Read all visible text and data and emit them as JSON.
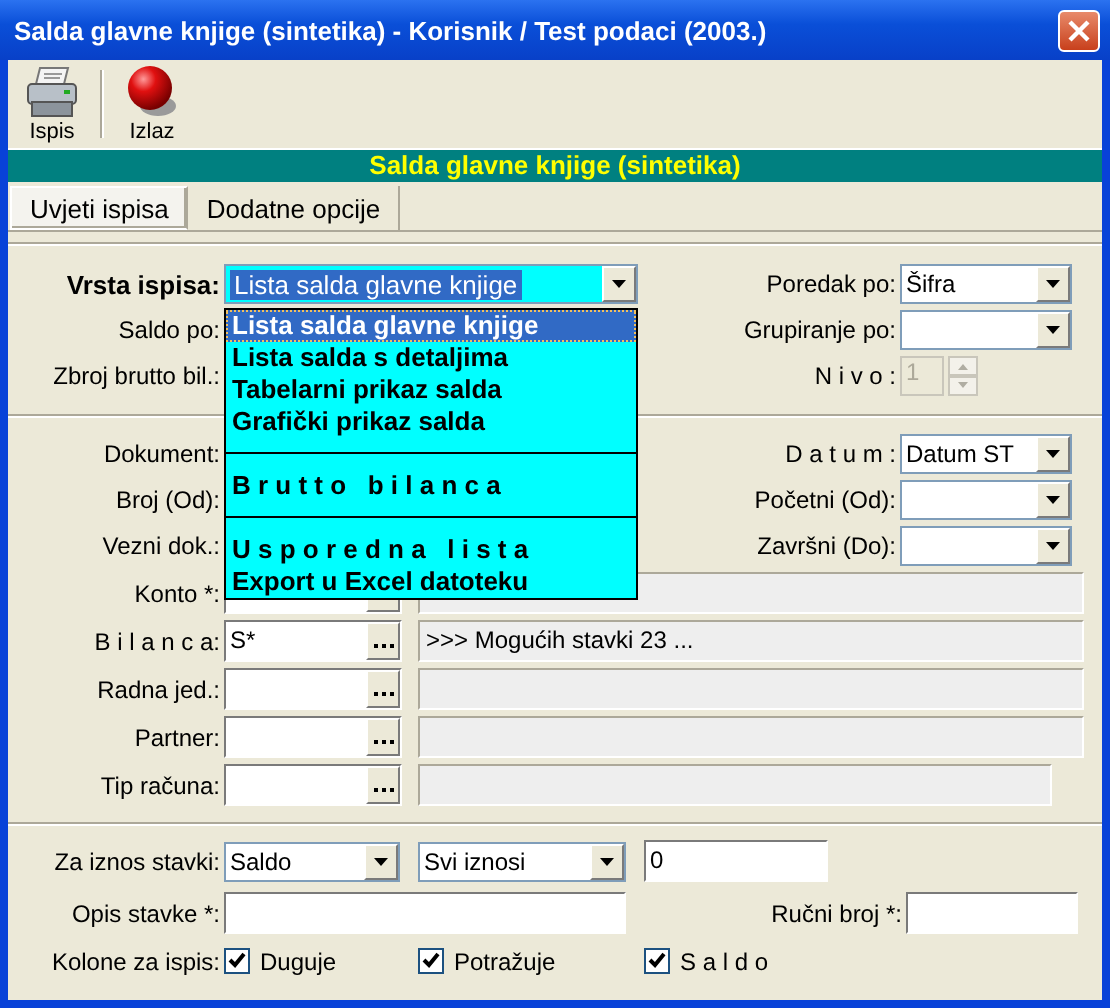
{
  "window": {
    "title": "Salda glavne knjige (sintetika) - Korisnik / Test podaci (2003.)"
  },
  "toolbar": [
    {
      "kind": "print",
      "label": "Ispis"
    },
    {
      "kind": "exit",
      "label": "Izlaz"
    }
  ],
  "header": "Salda glavne knjige (sintetika)",
  "tabs": [
    {
      "label": "Uvjeti ispisa",
      "selected": true
    },
    {
      "label": "Dodatne opcije",
      "selected": false
    }
  ],
  "section_1": [
    {
      "left": {
        "label": "Vrsta ispisa:",
        "kind": "combo",
        "value": "Lista salda glavne knjige",
        "expanded": true,
        "focused": true
      },
      "right": {
        "label": "Poredak po:",
        "kind": "combo",
        "value": "Šifra"
      }
    },
    {
      "left": {
        "label": "Saldo po:"
      },
      "right": {
        "label": "Grupiranje po:",
        "kind": "combo"
      }
    },
    {
      "left": {
        "label": "Zbroj brutto bil.:"
      },
      "right": {
        "label": "N i v o :",
        "kind": "spin",
        "value": "1",
        "disabled": true
      }
    }
  ],
  "report_options": [
    {
      "kind": "option",
      "label": "Lista salda glavne knjige",
      "selected": true
    },
    {
      "kind": "option",
      "label": "Lista salda s detaljima",
      "selected": false
    },
    {
      "kind": "option",
      "label": "Tabelarni prikaz salda",
      "selected": false
    },
    {
      "kind": "option",
      "label": "Grafički prikaz salda",
      "selected": false
    },
    {
      "kind": "separator"
    },
    {
      "kind": "option",
      "label": "B r u t t o   b i l a n c a",
      "selected": false
    },
    {
      "kind": "separator"
    },
    {
      "kind": "option",
      "label": "U s p o r e d n a   l i s t a",
      "selected": false
    },
    {
      "kind": "option",
      "label": "Export u Excel datoteku",
      "selected": false
    }
  ],
  "section_2": [
    {
      "left": {
        "label": "Dokument:"
      },
      "right": {
        "label": "D a t u m :",
        "kind": "combo",
        "value": "Datum ST"
      }
    },
    {
      "left": {
        "label": "Broj (Od):"
      },
      "right": {
        "label": "Početni (Od):",
        "kind": "combo"
      }
    },
    {
      "left": {
        "label": "Vezni dok.:"
      },
      "right": {
        "label": "Završni (Do):",
        "kind": "combo"
      }
    }
  ],
  "lookups": [
    {
      "label": "Konto *:"
    },
    {
      "label": "B i l a n c a:",
      "value": "S*",
      "info": ">>> Mogućih stavki 23 ..."
    },
    {
      "label": "Radna jed.:"
    },
    {
      "label": "Partner:"
    },
    {
      "label": "Tip računa:"
    }
  ],
  "amount": {
    "label": "Za iznos stavki:",
    "basis": "Saldo",
    "range": "Svi iznosi",
    "value": "0"
  },
  "description": {
    "label": "Opis stavke *:"
  },
  "manual_number": {
    "label": "Ručni broj *:"
  },
  "columns": {
    "label": "Kolone za ispis:",
    "options": [
      {
        "label": "Duguje",
        "checked": true
      },
      {
        "label": "Potražuje",
        "checked": true
      },
      {
        "label": "S a l d o",
        "checked": true
      }
    ]
  }
}
